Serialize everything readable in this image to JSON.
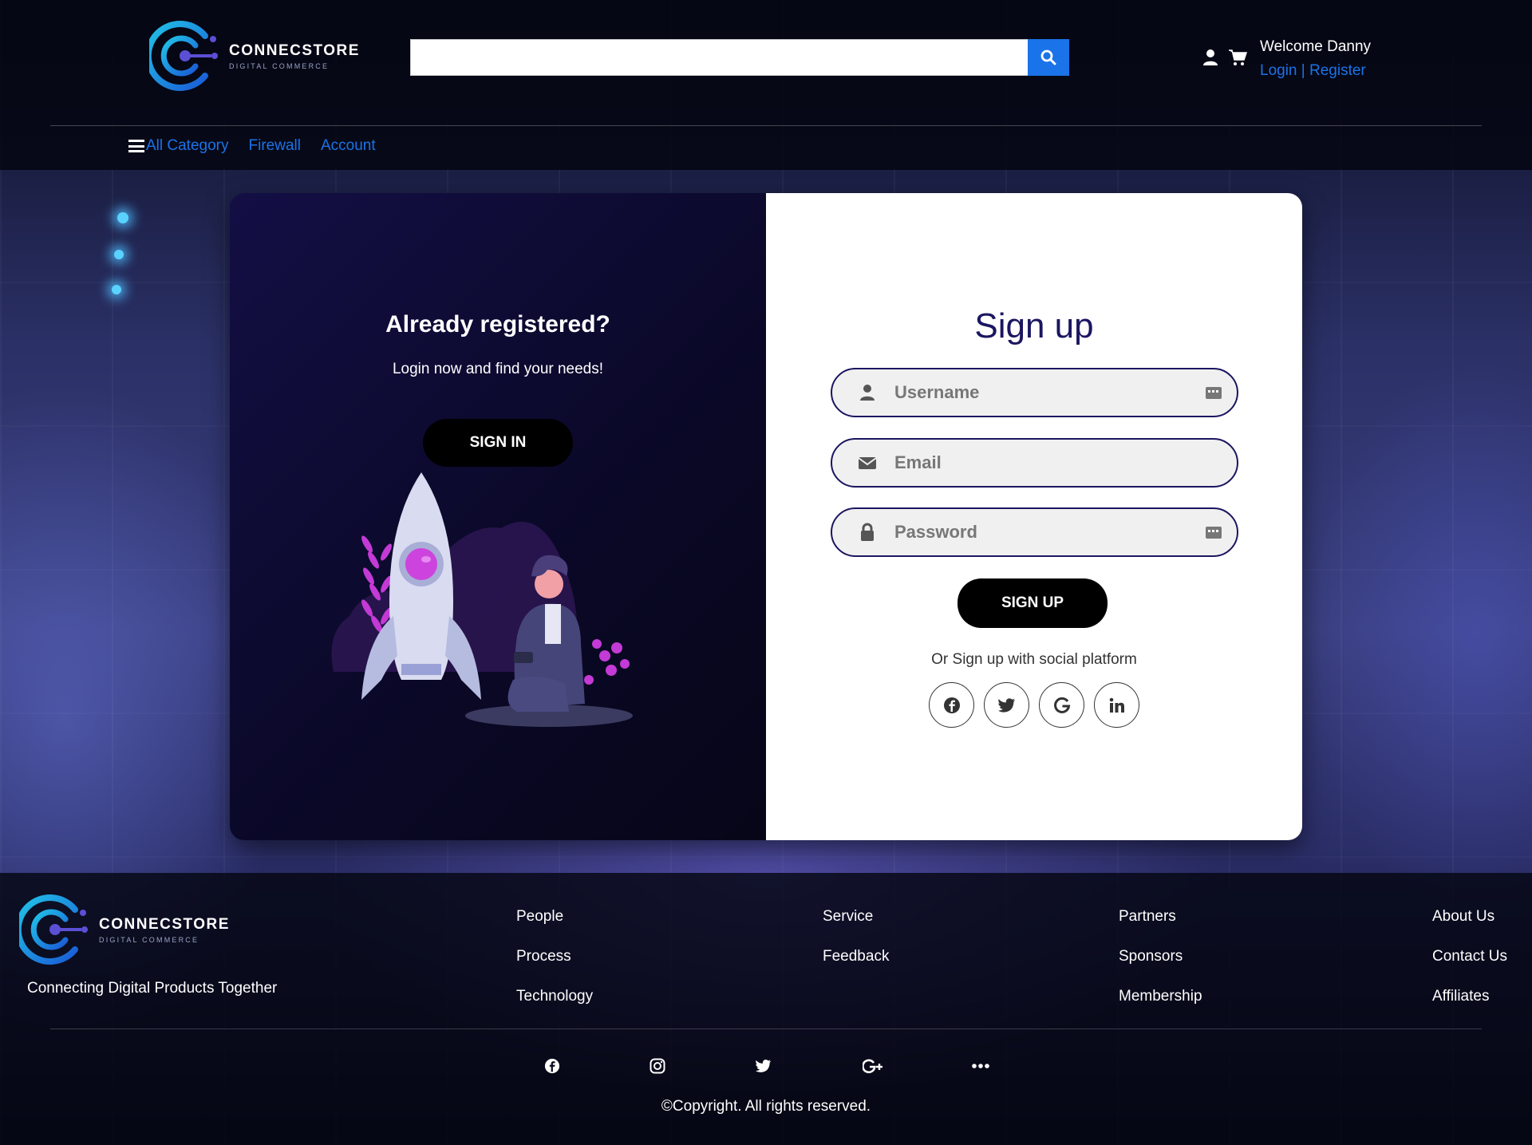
{
  "brand": {
    "name": "CONNECSTORE",
    "tagline": "DIGITAL COMMERCE"
  },
  "search": {
    "placeholder": "",
    "value": ""
  },
  "header": {
    "welcome": "Welcome Danny",
    "login_label": "Login",
    "separator": " | ",
    "register_label": "Register"
  },
  "nav": {
    "items": [
      {
        "label": "All Category"
      },
      {
        "label": "Firewall"
      },
      {
        "label": "Account"
      }
    ]
  },
  "left_panel": {
    "title": "Already registered?",
    "subtitle": "Login now and find your needs!",
    "signin_label": "SIGN IN"
  },
  "signup": {
    "title": "Sign up",
    "username_placeholder": "Username",
    "email_placeholder": "Email",
    "password_placeholder": "Password",
    "button_label": "SIGN UP",
    "social_text": "Or Sign up with social platform",
    "social_icons": [
      "facebook-icon",
      "twitter-icon",
      "google-icon",
      "linkedin-icon"
    ]
  },
  "footer": {
    "tagline": "Connecting Digital Products Together",
    "columns": [
      [
        "People",
        "Process",
        "Technology"
      ],
      [
        "Service",
        "Feedback"
      ],
      [
        "Partners",
        "Sponsors",
        "Membership"
      ],
      [
        "About Us",
        "Contact Us",
        "Affiliates"
      ]
    ],
    "social_icons": [
      "facebook-icon",
      "instagram-icon",
      "twitter-icon",
      "google-plus-icon",
      "more-icon"
    ],
    "copyright": "©Copyright. All rights reserved."
  },
  "colors": {
    "accent": "#1a73e8",
    "heading": "#1b1660",
    "button": "#000000"
  }
}
